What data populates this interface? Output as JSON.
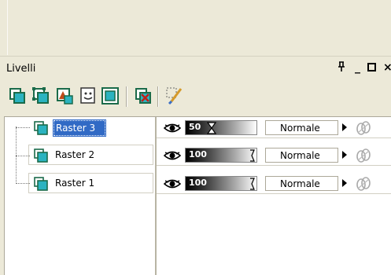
{
  "palette": {
    "title": "Livelli",
    "controls": {
      "pin": "ㅁ",
      "minimize": "_",
      "close": "×"
    }
  },
  "toolbar": {
    "icons": [
      "new-raster-layer-icon",
      "new-vector-layer-icon",
      "new-adjustment-layer-icon",
      "new-mask-layer-icon",
      "new-layer-group-icon",
      "delete-layer-icon",
      "edit-selection-icon"
    ]
  },
  "layers": [
    {
      "name": "Raster 3",
      "selected": true,
      "visible": true,
      "opacity": "50",
      "blend_mode": "Normale"
    },
    {
      "name": "Raster 2",
      "selected": false,
      "visible": true,
      "opacity": "100",
      "blend_mode": "Normale"
    },
    {
      "name": "Raster 1",
      "selected": false,
      "visible": true,
      "opacity": "100",
      "blend_mode": "Normale"
    }
  ],
  "colors": {
    "selection": "#316ac5",
    "background": "#ece9d8",
    "layer_icon": "#2bb3c0"
  }
}
